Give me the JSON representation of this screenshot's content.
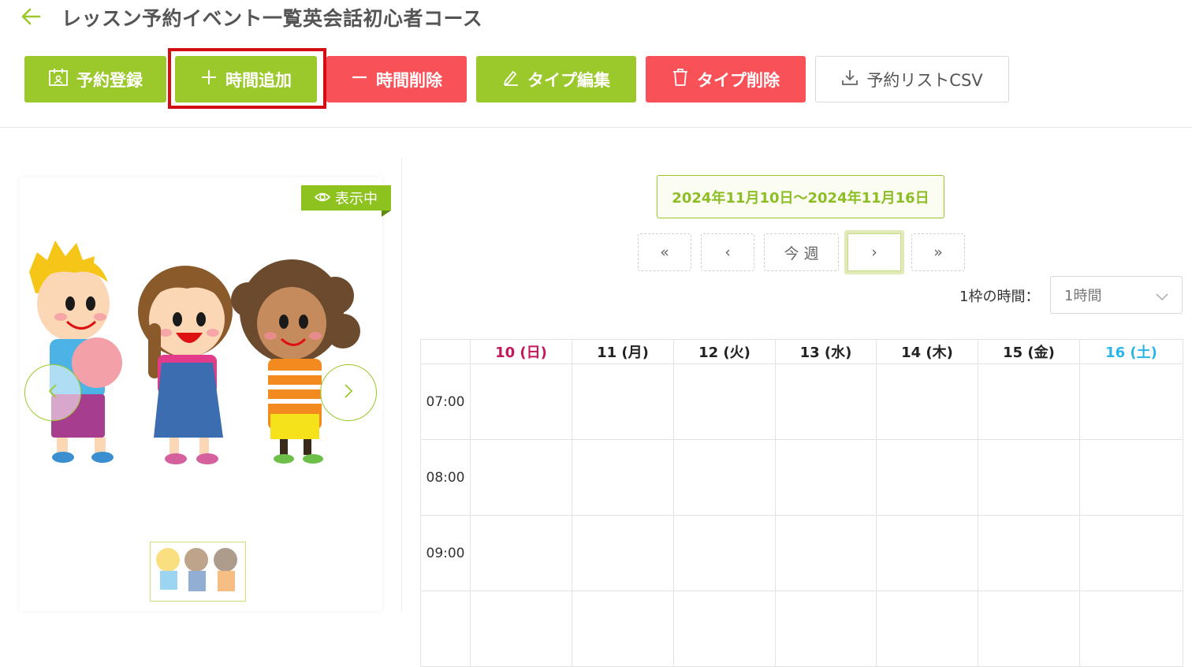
{
  "header": {
    "title": "レッスン予約イベント一覧英会話初心者コース"
  },
  "toolbar": {
    "buttons": [
      {
        "label": "予約登録",
        "icon": "calendar-user-icon",
        "color": "#9bc82a"
      },
      {
        "label": "時間追加",
        "icon": "plus-icon",
        "color": "#9bc82a"
      },
      {
        "label": "時間削除",
        "icon": "minus-icon",
        "color": "#f95158"
      },
      {
        "label": "タイプ編集",
        "icon": "edit-icon",
        "color": "#9bc82a"
      },
      {
        "label": "タイプ削除",
        "icon": "trash-icon",
        "color": "#f95158"
      },
      {
        "label": "予約リストCSV",
        "icon": "download-icon",
        "color": "#ffffff"
      }
    ]
  },
  "left_panel": {
    "status": "表示中",
    "status_icon": "eye-icon"
  },
  "calendar": {
    "date_range": "2024年11月10日～2024年11月16日",
    "nav": {
      "first": "«",
      "prev": "‹",
      "today": "今 週",
      "next": "›",
      "last": "»"
    },
    "slot_label": "1枠の時間：",
    "slot_value": "1時間",
    "days": [
      {
        "label": "10 (日)",
        "kind": "sun"
      },
      {
        "label": "11 (月)",
        "kind": "weekday"
      },
      {
        "label": "12 (火)",
        "kind": "weekday"
      },
      {
        "label": "13 (水)",
        "kind": "weekday"
      },
      {
        "label": "14 (木)",
        "kind": "weekday"
      },
      {
        "label": "15 (金)",
        "kind": "weekday"
      },
      {
        "label": "16 (土)",
        "kind": "sat"
      }
    ],
    "times": [
      "07:00",
      "08:00",
      "09:00",
      ""
    ]
  },
  "colors": {
    "accent_green": "#9bc82a",
    "danger_red": "#f95158",
    "sunday": "#c2185b",
    "saturday": "#29b6e6"
  }
}
